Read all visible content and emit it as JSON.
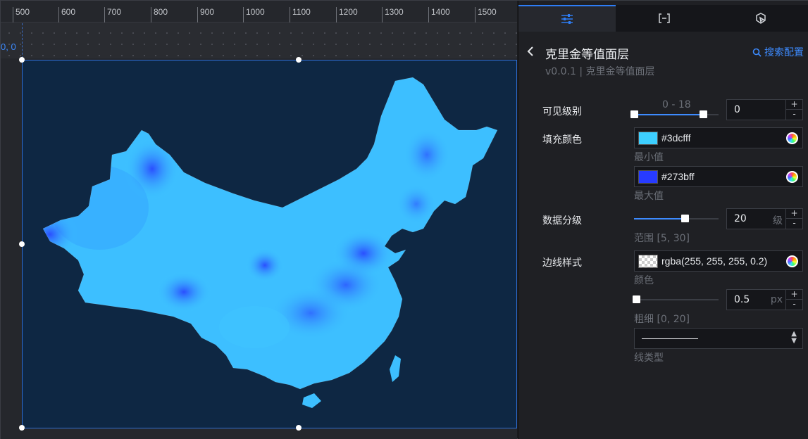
{
  "ruler": {
    "ticks": [
      "500",
      "600",
      "700",
      "800",
      "900",
      "1000",
      "1100",
      "1200",
      "1300",
      "1400",
      "1500"
    ]
  },
  "canvas": {
    "coord_label": "0, 0"
  },
  "panel": {
    "tabs": [
      {
        "name": "style-tab",
        "icon": "sliders-icon"
      },
      {
        "name": "data-tab",
        "icon": "bracket-icon"
      },
      {
        "name": "interaction-tab",
        "icon": "pointer-icon"
      }
    ],
    "title": "克里金等值面层",
    "version": "v0.0.1 | 克里金等值面层",
    "search_label": "搜索配置",
    "visible_level": {
      "label": "可见级别",
      "range_text": "0 - 18",
      "value": "0",
      "min": 0,
      "max": 18,
      "low": 0,
      "high": 18
    },
    "fill_color": {
      "label": "填充颜色",
      "min_value": "#3dcfff",
      "min_caption": "最小值",
      "max_value": "#273bff",
      "max_caption": "最大值"
    },
    "data_levels": {
      "label": "数据分级",
      "value": "20",
      "unit": "级",
      "range_caption": "范围 [5, 30]",
      "min": 5,
      "max": 30
    },
    "border_style": {
      "label": "边线样式",
      "color_value": "rgba(255, 255, 255, 0.2)",
      "color_caption": "颜色",
      "width_value": "0.5",
      "width_unit": "px",
      "width_caption": "粗细 [0, 20]",
      "width_min": 0,
      "width_max": 20,
      "line_type_caption": "线类型"
    }
  },
  "colors": {
    "accent": "#2d7df6",
    "min_fill": "#3dcfff",
    "max_fill": "#273bff",
    "map_bg": "#0e2743"
  }
}
